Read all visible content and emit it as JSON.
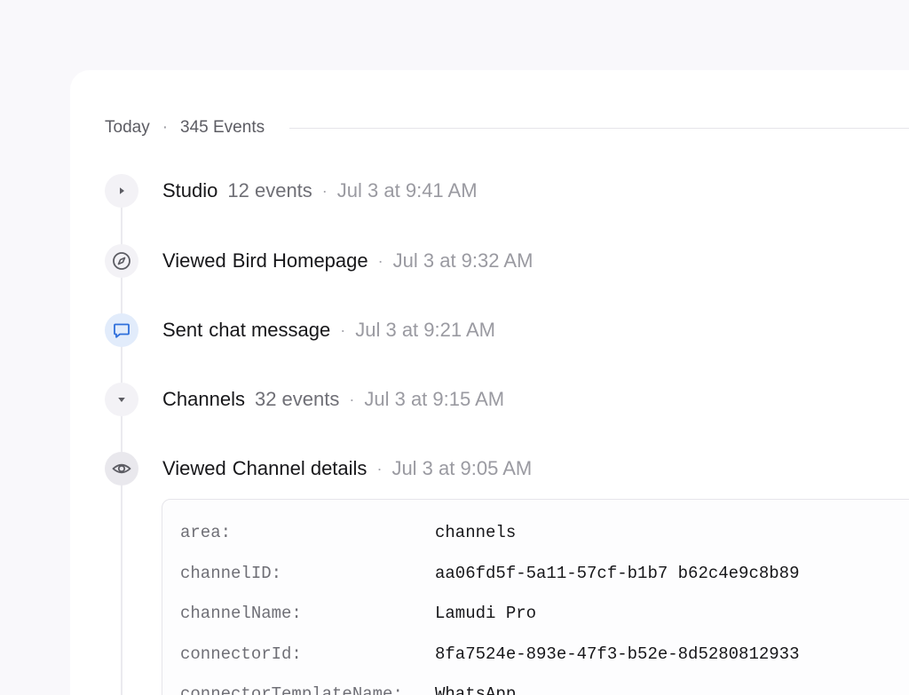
{
  "header": {
    "day": "Today",
    "separator": "·",
    "count": "345 Events"
  },
  "events": [
    {
      "icon": "caret-right-icon",
      "action": "Studio",
      "object": "",
      "count": "12 events",
      "dot": "·",
      "time": "Jul 3 at 9:41 AM"
    },
    {
      "icon": "compass-icon",
      "action": "Viewed",
      "object": "Bird Homepage",
      "count": "",
      "dot": "·",
      "time": "Jul 3 at 9:32 AM"
    },
    {
      "icon": "chat-bubble-icon",
      "action": "Sent",
      "object": "chat message",
      "count": "",
      "dot": "·",
      "time": "Jul 3 at 9:21 AM"
    },
    {
      "icon": "caret-down-icon",
      "action": "Channels",
      "object": "",
      "count": "32 events",
      "dot": "·",
      "time": "Jul 3 at 9:15 AM"
    },
    {
      "icon": "eye-icon",
      "action": "Viewed",
      "object": "Channel details",
      "count": "",
      "dot": "·",
      "time": "Jul 3 at 9:05 AM"
    }
  ],
  "properties": [
    {
      "key": "area:",
      "value": "channels"
    },
    {
      "key": "channelID:",
      "value": "aa06fd5f-5a11-57cf-b1b7 b62c4e9c8b89"
    },
    {
      "key": "channelName:",
      "value": "Lamudi Pro"
    },
    {
      "key": "connectorId:",
      "value": "8fa7524e-893e-47f3-b52e-8d5280812933"
    },
    {
      "key": "connectorTemplateName:",
      "value": "WhatsApp"
    }
  ],
  "colors": {
    "background": "#f9f8fb",
    "panel": "#ffffff",
    "accent_blue": "#2f6fdb",
    "text_primary": "#17171a",
    "text_muted": "#9a9aa1"
  }
}
